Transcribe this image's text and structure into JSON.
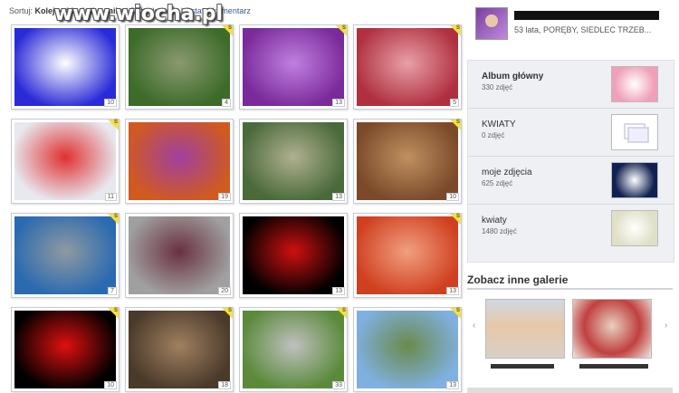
{
  "watermark": "www.wiocha.pl",
  "sort": {
    "label": "Sortuj:",
    "options": [
      "Kolejność użytkownika",
      "Data dodania",
      "Ostatni komentarz"
    ]
  },
  "photos": [
    {
      "count": "10",
      "badge": "",
      "colors": [
        "#2a2ad8",
        "#ffffff"
      ]
    },
    {
      "count": "4",
      "badge": "S",
      "colors": [
        "#3c6b2a",
        "#8b9970"
      ]
    },
    {
      "count": "13",
      "badge": "S",
      "colors": [
        "#7a2a9a",
        "#c080e0"
      ]
    },
    {
      "count": "5",
      "badge": "S",
      "colors": [
        "#b03040",
        "#e8a0a8"
      ]
    },
    {
      "count": "11",
      "badge": "S",
      "colors": [
        "#e8e8f0",
        "#e03030"
      ]
    },
    {
      "count": "19",
      "badge": "",
      "colors": [
        "#d05a20",
        "#a040a0"
      ]
    },
    {
      "count": "13",
      "badge": "",
      "colors": [
        "#4a6a3a",
        "#b0b090"
      ]
    },
    {
      "count": "10",
      "badge": "S",
      "colors": [
        "#7a4a2a",
        "#c09060"
      ]
    },
    {
      "count": "7",
      "badge": "S",
      "colors": [
        "#2a6ab0",
        "#909aa0"
      ]
    },
    {
      "count": "20",
      "badge": "",
      "colors": [
        "#a0a0a0",
        "#6a3040"
      ]
    },
    {
      "count": "13",
      "badge": "",
      "colors": [
        "#000000",
        "#d01010"
      ]
    },
    {
      "count": "13",
      "badge": "S",
      "colors": [
        "#d04020",
        "#f0a080"
      ]
    },
    {
      "count": "10",
      "badge": "S",
      "colors": [
        "#000000",
        "#e01010"
      ]
    },
    {
      "count": "18",
      "badge": "S",
      "colors": [
        "#4a3a2a",
        "#a08060"
      ]
    },
    {
      "count": "33",
      "badge": "S",
      "colors": [
        "#5a8a3a",
        "#c0c0c0"
      ]
    },
    {
      "count": "13",
      "badge": "S",
      "colors": [
        "#80b0e0",
        "#6a8a4a"
      ]
    }
  ],
  "profile": {
    "info": "53 lata, PORĘBY, SIEDLEC TRZEB..."
  },
  "albums": [
    {
      "title": "Album główny",
      "count": "330 zdjęć",
      "thumb": "#f0a0b8"
    },
    {
      "title": "KWIATY",
      "count": "0 zdjęć",
      "thumb": "#f4f6fa"
    },
    {
      "title": "moje zdjęcia",
      "count": "625 zdjęć",
      "thumb": "#102050"
    },
    {
      "title": "kwiaty",
      "count": "1480 zdjęć",
      "thumb": "#e0e0c8"
    }
  ],
  "other_galleries": {
    "title": "Zobacz inne galerie",
    "prev": "‹",
    "next": "›"
  }
}
